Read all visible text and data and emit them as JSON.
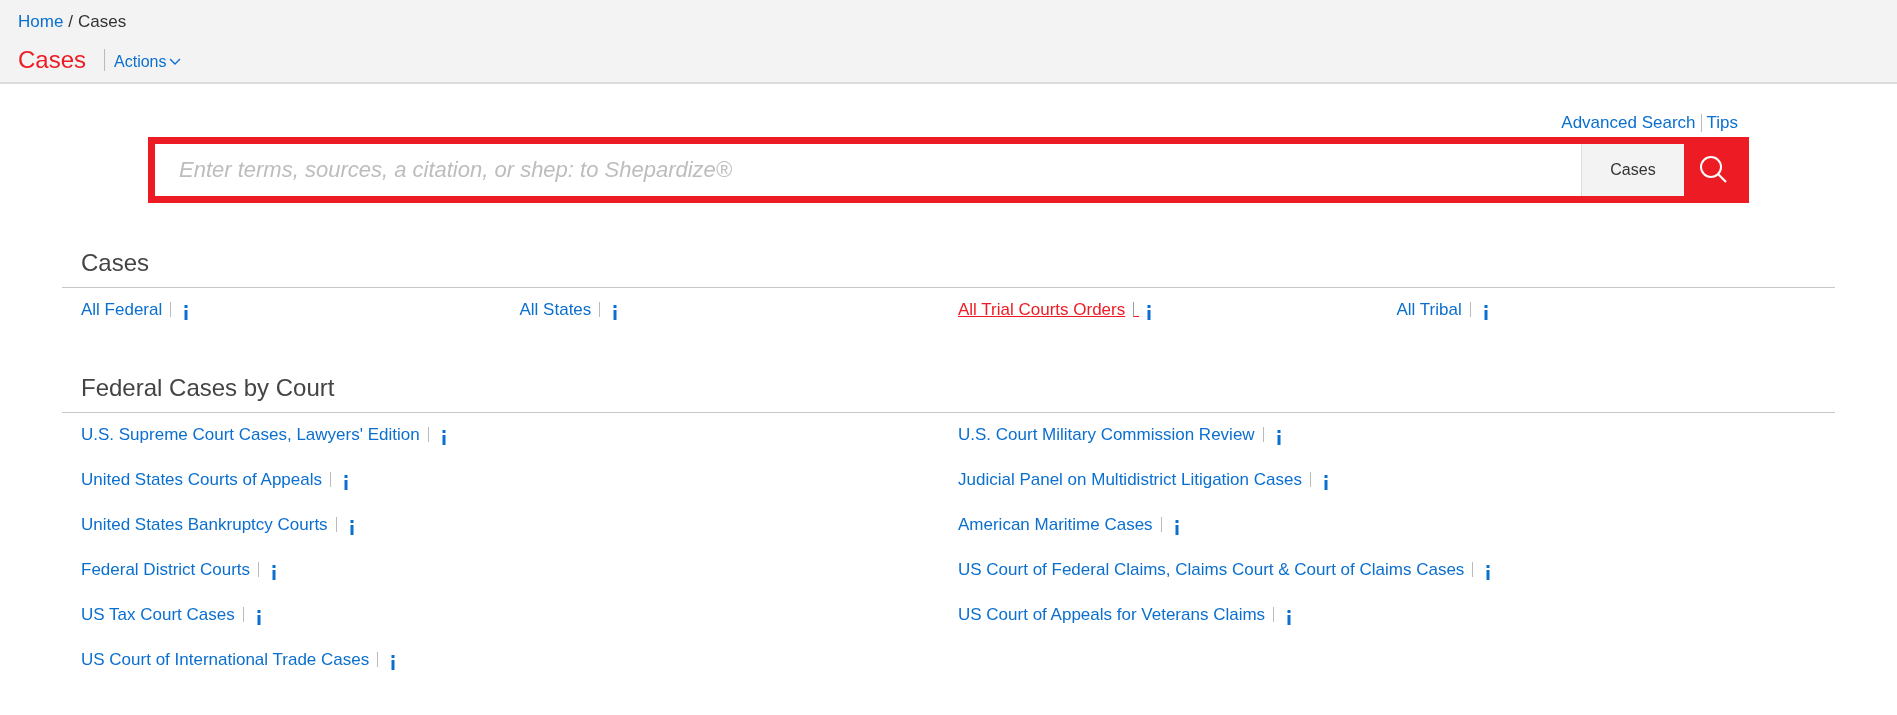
{
  "breadcrumb": [
    {
      "label": "Home",
      "kind": "link"
    },
    {
      "label": "/",
      "kind": "separator"
    },
    {
      "label": "Cases",
      "kind": "current"
    }
  ],
  "page_title": "Cases",
  "actions_menu": {
    "label": "Actions"
  },
  "search_links": [
    "Advanced Search",
    "Tips"
  ],
  "search": {
    "placeholder": "Enter terms, sources, a citation, or shep: to Shepardize®",
    "scope": "Cases"
  },
  "sections": [
    {
      "title": "Cases",
      "items": [
        {
          "label": "All Federal",
          "hovered": false
        },
        {
          "label": "All States",
          "hovered": false
        },
        {
          "label": "All Trial Courts Orders",
          "hovered": true
        },
        {
          "label": "All Tribal",
          "hovered": false
        }
      ]
    },
    {
      "title": "Federal Cases by Court",
      "items": [
        {
          "label": "U.S. Supreme Court Cases, Lawyers' Edition",
          "hovered": false
        },
        {
          "label": "U.S. Court Military Commission Review",
          "hovered": false
        },
        {
          "label": "United States Courts of Appeals",
          "hovered": false
        },
        {
          "label": "Judicial Panel on Multidistrict Litigation Cases",
          "hovered": false
        },
        {
          "label": "United States Bankruptcy Courts",
          "hovered": false
        },
        {
          "label": "American Maritime Cases",
          "hovered": false
        },
        {
          "label": "Federal District Courts",
          "hovered": false
        },
        {
          "label": "US Court of Federal Claims, Claims Court & Court of Claims Cases",
          "hovered": false
        },
        {
          "label": "US Tax Court Cases",
          "hovered": false
        },
        {
          "label": "US Court of Appeals for Veterans Claims",
          "hovered": false
        },
        {
          "label": "US Court of International Trade Cases",
          "hovered": false
        }
      ]
    }
  ]
}
